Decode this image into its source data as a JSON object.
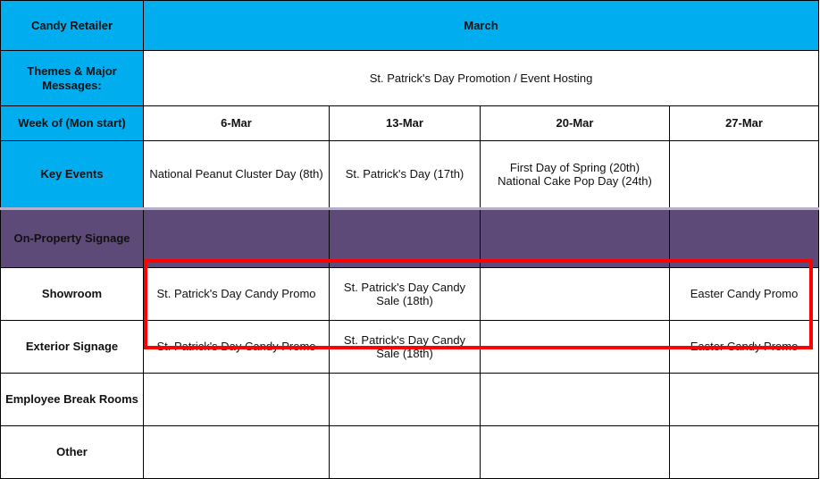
{
  "sheet": {
    "title": "Candy Retailer",
    "month": "March",
    "colors": {
      "header_cyan": "#00AEEF",
      "section_purple": "#5D4A78",
      "section_purple_top_rule": "#B6B0CC",
      "highlight_red": "#FF0000",
      "grid_black": "#000000",
      "text_dark": "#111111",
      "cell_white": "#FFFFFF"
    }
  },
  "rows": {
    "themes": {
      "label": "Themes & Major Messages:",
      "value": "St. Patrick's Day Promotion / Event Hosting"
    },
    "week_of": {
      "label": "Week of (Mon start)",
      "dates": [
        "6-Mar",
        "13-Mar",
        "20-Mar",
        "27-Mar"
      ]
    },
    "key_events": {
      "label": "Key Events",
      "cells": [
        "National Peanut Cluster Day (8th)",
        "St. Patrick's Day (17th)",
        "First Day of Spring (20th)\nNational Cake Pop Day (24th)",
        ""
      ]
    },
    "on_property_signage": {
      "label": "On-Property Signage"
    },
    "showroom": {
      "label": "Showroom",
      "cells": [
        "St. Patrick's Day Candy Promo",
        "St. Patrick's Day Candy Sale (18th)",
        "",
        "Easter Candy Promo"
      ]
    },
    "exterior_signage": {
      "label": "Exterior Signage",
      "cells": [
        "St. Patrick's Day Candy Promo",
        "St. Patrick's Day Candy Sale (18th)",
        "",
        "Easter Candy Promo"
      ]
    },
    "employee_break_rooms": {
      "label": "Employee Break Rooms",
      "cells": [
        "",
        "",
        "",
        ""
      ]
    },
    "other": {
      "label": "Other",
      "cells": [
        "",
        "",
        "",
        ""
      ]
    }
  },
  "highlight": {
    "name": "red-selection-box",
    "description": "Red rectangle outlining the Showroom and Exterior Signage week cells"
  }
}
